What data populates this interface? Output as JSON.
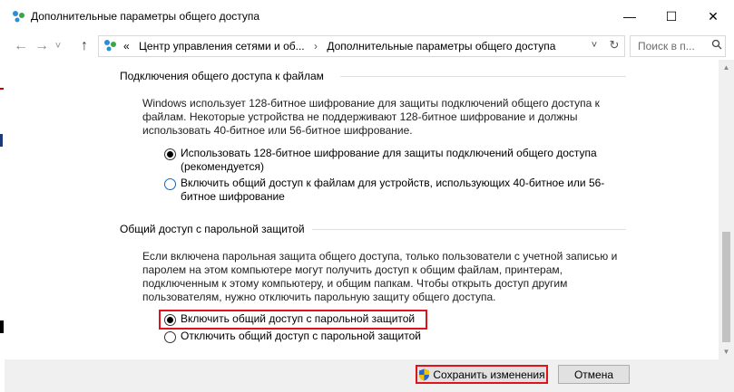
{
  "window": {
    "title": "Дополнительные параметры общего доступа",
    "minimize_glyph": "—",
    "maximize_glyph": "☐",
    "close_glyph": "✕"
  },
  "nav": {
    "back_glyph": "←",
    "forward_glyph": "→",
    "recent_glyph": "˅",
    "up_glyph": "↑",
    "breadcrumb_chevron": "«",
    "breadcrumb": [
      "Центр управления сетями и об...",
      "Дополнительные параметры общего доступа"
    ],
    "breadcrumb_separator": "›",
    "dropdown_glyph": "˅",
    "refresh_glyph": "↻",
    "search_placeholder": "Поиск в п..."
  },
  "sections": [
    {
      "heading": "Подключения общего доступа к файлам",
      "paragraph": "Windows использует 128-битное шифрование для защиты подключений общего доступа к файлам. Некоторые устройства не поддерживают 128-битное шифрование и должны использовать 40-битное или 56-битное шифрование.",
      "options": [
        {
          "label": "Использовать 128-битное шифрование для защиты подключений общего доступа (рекомендуется)",
          "selected": true
        },
        {
          "label": "Включить общий доступ к файлам для устройств, использующих 40-битное или 56-битное шифрование",
          "selected": false
        }
      ]
    },
    {
      "heading": "Общий доступ с парольной защитой",
      "paragraph": "Если включена парольная защита общего доступа, только пользователи с учетной записью и паролем на этом компьютере могут получить доступ к общим файлам, принтерам, подключенным к этому компьютеру, и общим папкам. Чтобы открыть доступ другим пользователям, нужно отключить парольную защиту общего доступа.",
      "options": [
        {
          "label": "Включить общий доступ с парольной защитой",
          "selected": true
        },
        {
          "label": "Отключить общий доступ с парольной защитой",
          "selected": false
        }
      ]
    }
  ],
  "scrollbar": {
    "up_glyph": "▲",
    "down_glyph": "▼"
  },
  "footer": {
    "save_label": "Сохранить изменения",
    "cancel_label": "Отмена"
  },
  "colors": {
    "highlight": "#e0121c",
    "footer_bg": "#f0f0f0",
    "button_bg": "#e1e1e1"
  }
}
